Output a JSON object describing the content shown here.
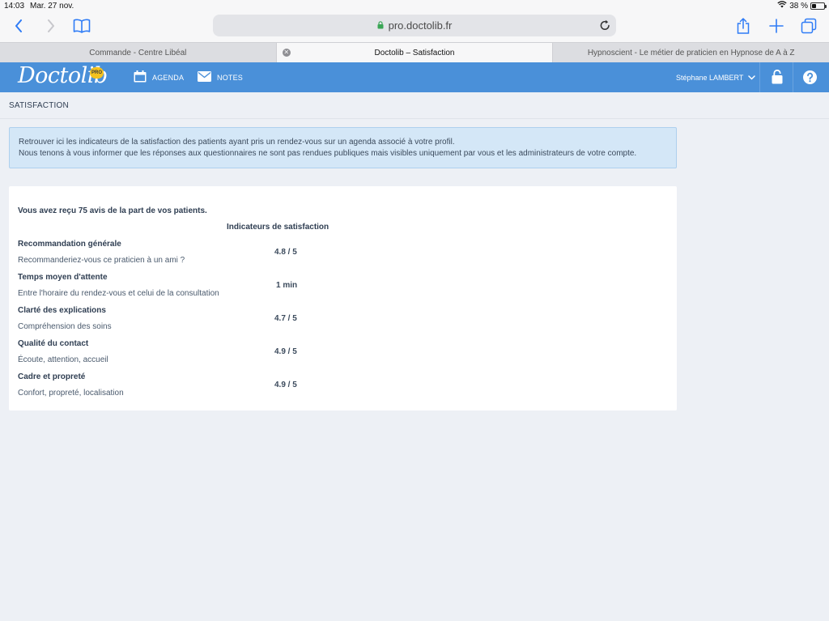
{
  "status_bar": {
    "time": "14:03",
    "date": "Mar. 27 nov.",
    "battery": "38 %",
    "battery_level": 0.38
  },
  "browser": {
    "url": "pro.doctolib.fr",
    "tabs": [
      {
        "label": "Commande - Centre Libéal",
        "active": false
      },
      {
        "label": "Doctolib – Satisfaction",
        "active": true
      },
      {
        "label": "Hypnoscient - Le métier de praticien en Hypnose de A à Z",
        "active": false
      }
    ]
  },
  "app": {
    "logo": "Doctolib",
    "badge": "PRO",
    "nav": {
      "agenda": "AGENDA",
      "notes": "NOTES"
    },
    "user": "Stéphane LAMBERT",
    "brand_color": "#4a90d9"
  },
  "page": {
    "title": "SATISFACTION",
    "info_line1": "Retrouver ici les indicateurs de la satisfaction des patients ayant pris un rendez-vous sur un agenda associé à votre profil.",
    "info_line2": "Nous tenons à vous informer que les réponses aux questionnaires ne sont pas rendues publiques mais visibles uniquement par vous et les administrateurs de votre compte.",
    "summary": "Vous avez reçu 75 avis de la part de vos patients.",
    "column_header": "Indicateurs de satisfaction",
    "indicators": [
      {
        "title": "Recommandation générale",
        "subtitle": "Recommanderiez-vous ce praticien à un ami ?",
        "value": "4.8 / 5"
      },
      {
        "title": "Temps moyen d'attente",
        "subtitle": "Entre l'horaire du rendez-vous et celui de la consultation",
        "value": "1 min"
      },
      {
        "title": "Clarté des explications",
        "subtitle": "Compréhension des soins",
        "value": "4.7 / 5"
      },
      {
        "title": "Qualité du contact",
        "subtitle": "Écoute, attention, accueil",
        "value": "4.9 / 5"
      },
      {
        "title": "Cadre et propreté",
        "subtitle": "Confort, propreté, localisation",
        "value": "4.9 / 5"
      }
    ]
  }
}
